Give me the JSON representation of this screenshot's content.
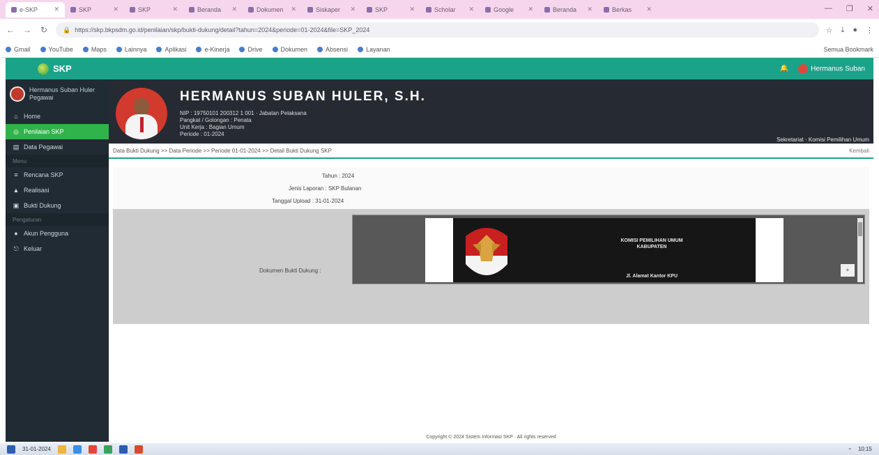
{
  "browser": {
    "tabs": [
      "e-SKP",
      "SKP",
      "SKP",
      "Beranda",
      "Dokumen",
      "Siskaper",
      "SKP",
      "Scholar",
      "Google",
      "Beranda",
      "Berkas"
    ],
    "window_controls": [
      "—",
      "❐",
      "✕"
    ],
    "url": "https://skp.bkpsdm.go.id/penilaian/skp/bukti-dukung/detail?tahun=2024&periode=01-2024&file=SKP_2024",
    "bookmarks": [
      "Gmail",
      "YouTube",
      "Maps",
      "Lainnya",
      "Aplikasi",
      "e-Kinerja",
      "Drive",
      "Dokumen",
      "Absensi",
      "Layanan",
      "Semua Bookmark"
    ]
  },
  "header": {
    "brand": "SKP",
    "bell": "🔔",
    "user": "Hermanus Suban"
  },
  "sidebar": {
    "user_name": "Hermanus Suban Huler",
    "user_sub": "Pegawai",
    "items": [
      {
        "icon": "⌂",
        "label": "Home"
      },
      {
        "icon": "◎",
        "label": "Penilaian SKP",
        "active": true
      },
      {
        "icon": "▤",
        "label": "Data Pegawai"
      }
    ],
    "section1": "Menu",
    "items2": [
      {
        "icon": "≡",
        "label": "Rencana SKP"
      },
      {
        "icon": "▲",
        "label": "Realisasi"
      },
      {
        "icon": "▣",
        "label": "Bukti Dukung"
      }
    ],
    "section2": "Pengaturan",
    "items3": [
      {
        "icon": "●",
        "label": "Akun Pengguna"
      },
      {
        "icon": "⎋",
        "label": "Keluar"
      }
    ]
  },
  "profile": {
    "name": "HERMANUS SUBAN HULER, S.H.",
    "lines": [
      "NIP : 19750101 200312 1 001 · Jabatan Pelaksana",
      "Pangkat / Golongan : Penata",
      "Unit Kerja : Bagian Umum",
      "Periode : 01-2024"
    ],
    "right_text": "Sekretariat · Komisi Pemilihan Umum"
  },
  "breadcrumb": {
    "path": "Data Bukti Dukung  >>  Data Periode  >>  Periode 01-01-2024  >>  Detail Bukti Dukung SKP",
    "right": "Kembali"
  },
  "info": {
    "rows": [
      {
        "label": "Tahun",
        "value": "2024"
      },
      {
        "label": "Jenis Laporan",
        "value": "SKP Bulanan"
      },
      {
        "label": "Tanggal Upload",
        "value": "31-01-2024"
      }
    ],
    "doc_label": "Dokumen Bukti Dukung"
  },
  "document": {
    "title": "KOMISI PEMILIHAN UMUM",
    "subtitle": "KABUPATEN",
    "footer": "Jl. Alamat Kantor KPU",
    "zoom": "+"
  },
  "footer": "Copyright © 2024 Sistem Informasi SKP · All rights reserved",
  "taskbar": {
    "date": "31-01-2024",
    "clock": "10:15"
  }
}
